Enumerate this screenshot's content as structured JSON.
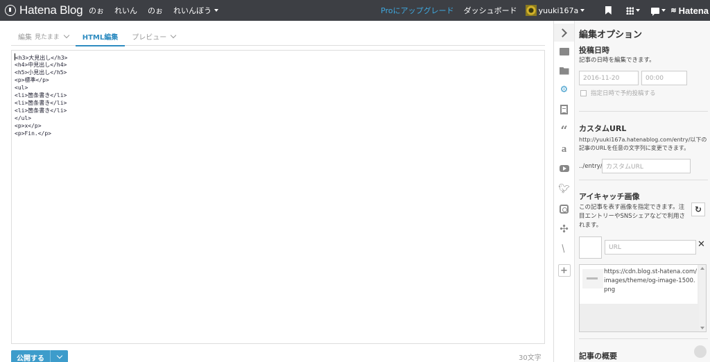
{
  "topbar": {
    "logo_text": "Hatena Blog",
    "blog_nav": [
      "のぉ",
      "れいん",
      "のぉ",
      "れいんぼう"
    ],
    "pro_link": "Proにアップグレード",
    "dashboard": "ダッシュボード",
    "username": "yuuki167a",
    "hatena_text": "Hatena"
  },
  "editor": {
    "tabs": [
      {
        "label": "編集",
        "sub": "見たまま"
      },
      {
        "label": "HTML編集"
      },
      {
        "label": "プレビュー"
      }
    ],
    "lines": [
      "<h3>大見出し</h3>",
      "<h4>中見出し</h4>",
      "<h5>小見出し</h5>",
      "<p>標準</p>",
      "<ul>",
      "<li>箇条書き</li>",
      "<li>箇条書き</li>",
      "<li>箇条書き</li>",
      "</ul>",
      "<p>x</p>",
      "<p>Fin.</p>"
    ],
    "publish_label": "公開する",
    "char_count": "30文字"
  },
  "panel": {
    "title": "編集オプション",
    "date_section": {
      "heading": "投稿日時",
      "desc": "記事の日時を編集できます。",
      "date_placeholder": "2016-11-20",
      "time_placeholder": "00:00",
      "schedule_label": "指定日時で予約投稿する"
    },
    "url_section": {
      "heading": "カスタムURL",
      "desc": "http://yuuki167a.hatenablog.com/entry/以下の記事のURLを任意の文字列に変更できます。",
      "prefix": "../entry/",
      "placeholder": "カスタムURL"
    },
    "eyecatch_section": {
      "heading": "アイキャッチ画像",
      "desc": "この記事を表す画像を指定できます。注目エントリーやSNSシェアなどで利用されます。",
      "url_placeholder": "URL",
      "candidate_url": "https://cdn.blog.st-hatena.com/images/theme/og-image-1500.png"
    },
    "summary_heading": "記事の概要"
  },
  "colors": {
    "topbar_bg": "#3d3f44",
    "accent": "#3d9ccb",
    "pro_link": "#3fa9e0"
  }
}
